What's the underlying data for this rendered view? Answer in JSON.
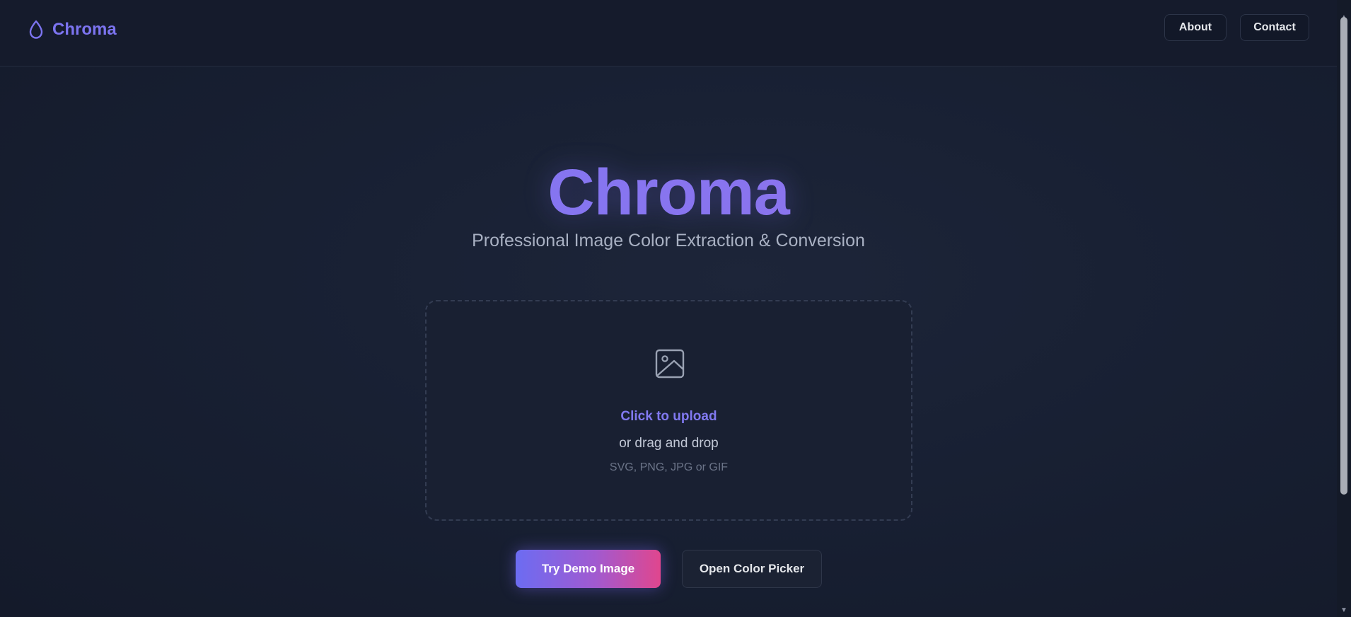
{
  "app": {
    "brand_name": "Chroma",
    "brand_icon": "droplet-icon"
  },
  "header": {
    "nav": [
      {
        "label": "About"
      },
      {
        "label": "Contact"
      }
    ]
  },
  "hero": {
    "title": "Chroma",
    "subtitle": "Professional Image Color Extraction & Conversion"
  },
  "upload": {
    "icon": "image-icon",
    "cta": "Click to upload",
    "secondary": "or drag and drop",
    "formats": "SVG, PNG, JPG or GIF"
  },
  "actions": {
    "demo_label": "Try Demo Image",
    "picker_label": "Open Color Picker"
  },
  "colors": {
    "accent": "#7c74f0",
    "gradient_start": "#6c6cf2",
    "gradient_end": "#e0468e",
    "background": "#161d2e"
  }
}
